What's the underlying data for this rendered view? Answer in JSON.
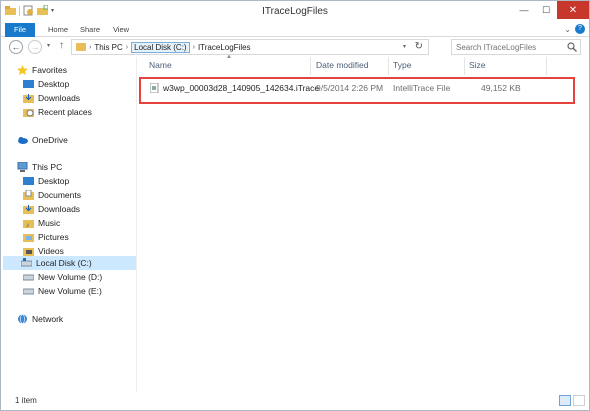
{
  "window": {
    "title": "ITraceLogFiles"
  },
  "ribbon": {
    "tabs": [
      "File",
      "Home",
      "Share",
      "View"
    ]
  },
  "address": {
    "crumbs": [
      "This PC",
      "Local Disk (C:)",
      "ITraceLogFiles"
    ]
  },
  "search": {
    "placeholder": "Search ITraceLogFiles"
  },
  "nav": {
    "favorites": "Favorites",
    "fav_items": [
      "Desktop",
      "Downloads",
      "Recent places"
    ],
    "onedrive": "OneDrive",
    "thispc": "This PC",
    "pc_items": [
      "Desktop",
      "Documents",
      "Downloads",
      "Music",
      "Pictures",
      "Videos",
      "Local Disk (C:)",
      "New Volume (D:)",
      "New Volume (E:)"
    ],
    "network": "Network"
  },
  "columns": {
    "name": "Name",
    "date": "Date modified",
    "type": "Type",
    "size": "Size"
  },
  "files": [
    {
      "name": "w3wp_00003d28_140905_142634.iTrace",
      "date": "9/5/2014 2:26 PM",
      "type": "IntelliTrace File",
      "size": "49,152 KB"
    }
  ],
  "status": {
    "count": "1 item"
  },
  "colors": {
    "accent": "#1979ca",
    "selection": "#cce8ff",
    "annotation": "#e5423c"
  }
}
